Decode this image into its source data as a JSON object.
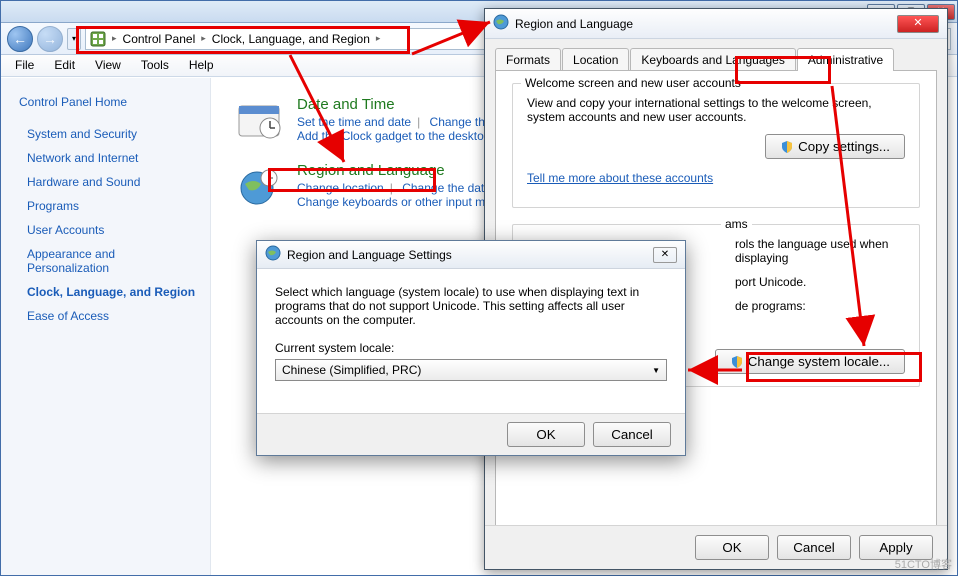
{
  "window": {
    "breadcrumb": {
      "root": "Control Panel",
      "leaf": "Clock, Language, and Region"
    },
    "menu": {
      "file": "File",
      "edit": "Edit",
      "view": "View",
      "tools": "Tools",
      "help": "Help"
    }
  },
  "sidebar": {
    "home": "Control Panel Home",
    "items": [
      "System and Security",
      "Network and Internet",
      "Hardware and Sound",
      "Programs",
      "User Accounts",
      "Appearance and Personalization",
      "Clock, Language, and Region",
      "Ease of Access"
    ]
  },
  "content": {
    "cat1": {
      "title": "Date and Time",
      "link1": "Set the time and date",
      "link2": "Change the time zone",
      "link3": "Add the Clock gadget to the desktop"
    },
    "cat2": {
      "title": "Region and Language",
      "link1": "Change location",
      "link2": "Change the date, time, or number format",
      "link3": "Change keyboards or other input methods"
    }
  },
  "rl": {
    "title": "Region and Language",
    "tabs": {
      "formats": "Formats",
      "location": "Location",
      "keyboards": "Keyboards and Languages",
      "admin": "Administrative"
    },
    "group1": {
      "title": "Welcome screen and new user accounts",
      "desc": "View and copy your international settings to the welcome screen, system accounts and new user accounts.",
      "btn": "Copy settings...",
      "link": "Tell me more about these accounts"
    },
    "group2": {
      "title_frag": "ams",
      "desc_frag1": "rols the language used when displaying",
      "desc_frag2": "port Unicode.",
      "label_frag": "de programs:",
      "btn": "Change system locale..."
    },
    "ok": "OK",
    "cancel": "Cancel",
    "apply": "Apply"
  },
  "sub": {
    "title": "Region and Language Settings",
    "desc": "Select which language (system locale) to use when displaying text in programs that do not support Unicode. This setting affects all user accounts on the computer.",
    "label": "Current system locale:",
    "value": "Chinese (Simplified, PRC)",
    "ok": "OK",
    "cancel": "Cancel"
  },
  "watermark": "51CTO博客"
}
